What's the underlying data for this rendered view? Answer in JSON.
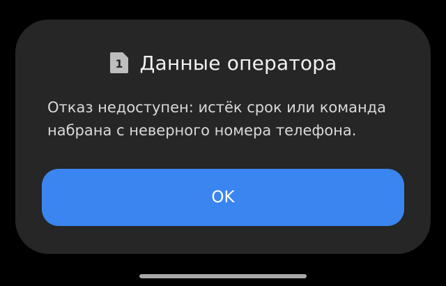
{
  "dialog": {
    "sim_badge": "1",
    "title": "Данные оператора",
    "message": "Отказ недоступен: истёк срок или команда\nнабрана с неверного номера телефона.",
    "ok_label": "OK"
  },
  "icons": {
    "sim": "sim-card-icon"
  },
  "colors": {
    "background": "#000000",
    "dialog_background": "#262626",
    "accent": "#3a85f0",
    "title_text": "#f2f2f2",
    "body_text": "#d9d9d9",
    "home_indicator": "#a8a8a8"
  }
}
